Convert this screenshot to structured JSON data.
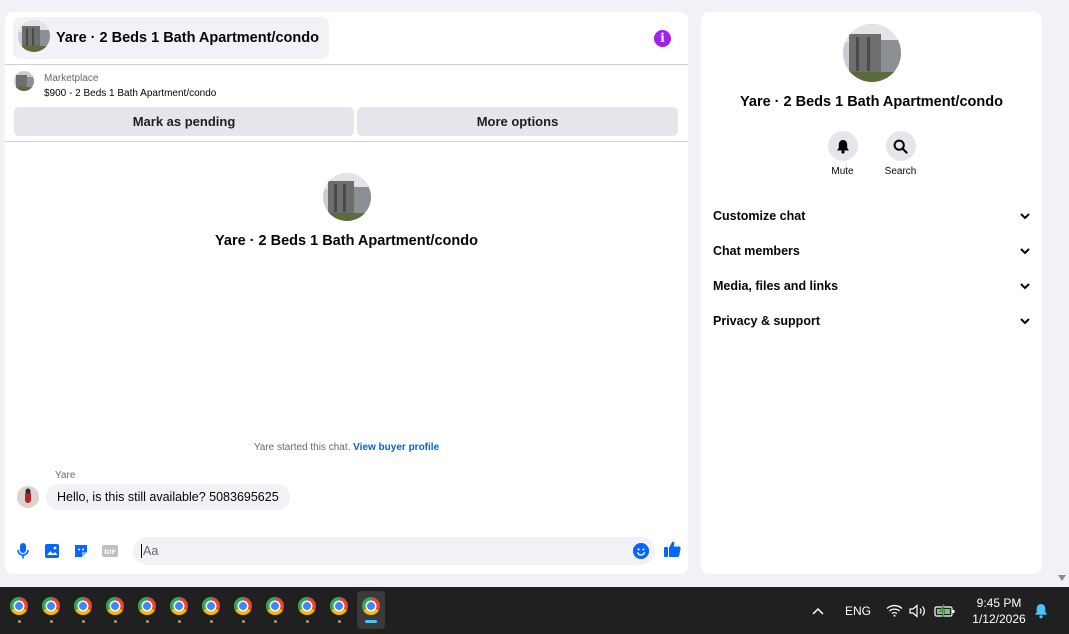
{
  "chat": {
    "title": "Yare · 2 Beds 1 Bath Apartment/condo",
    "info_icon": "info-icon",
    "listing": {
      "source": "Marketplace",
      "title": "$900 - 2 Beds 1 Bath Apartment/condo",
      "actions": [
        "Mark as pending",
        "More options"
      ]
    },
    "intro_name": "Yare · 2 Beds 1 Bath Apartment/condo",
    "system_message": "Yare started this chat.",
    "system_link": "View buyer profile",
    "messages": [
      {
        "sender": "Yare",
        "text": "Hello, is this still available? 5083695625"
      }
    ],
    "composer": {
      "placeholder": "Aa",
      "icons": [
        "microphone-icon",
        "photo-icon",
        "sticker-icon",
        "gif-icon",
        "emoji-icon",
        "thumbs-up-icon"
      ],
      "gif_label": "GIF"
    },
    "accent_color": "#0866ff"
  },
  "info_panel": {
    "name": "Yare · 2 Beds 1 Bath Apartment/condo",
    "quick_actions": [
      {
        "label": "Mute",
        "icon": "bell-icon"
      },
      {
        "label": "Search",
        "icon": "search-icon"
      }
    ],
    "sections": [
      "Customize chat",
      "Chat members",
      "Media, files and links",
      "Privacy & support"
    ]
  },
  "taskbar": {
    "app_count": 12,
    "active_index": 11,
    "app_icon": "chrome-icon",
    "language": "ENG",
    "time": "9:45 PM",
    "date": "1/12/2026",
    "tray_icons": [
      "chevron-up-icon",
      "wifi-icon",
      "volume-icon",
      "battery-icon",
      "notification-bell-icon"
    ]
  }
}
